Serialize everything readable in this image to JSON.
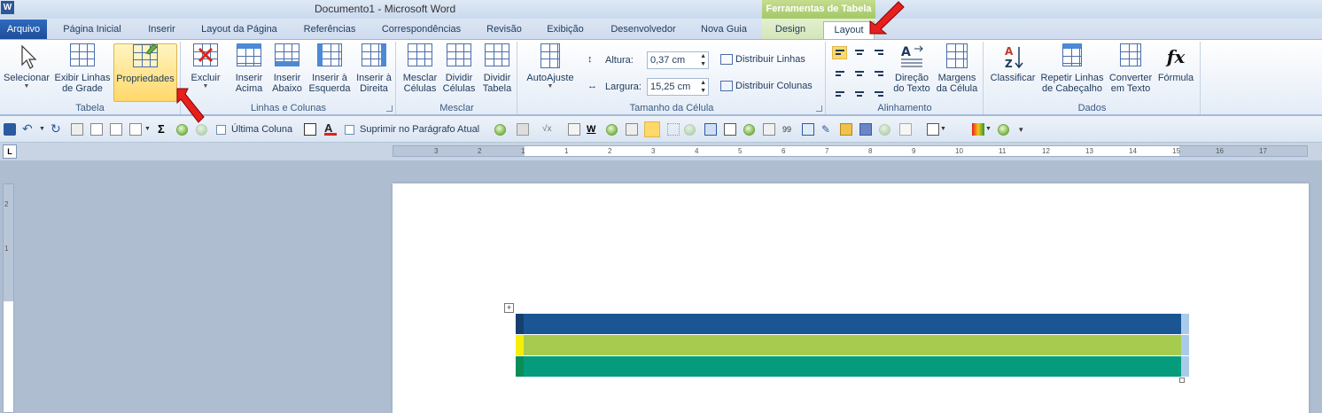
{
  "titlebar": {
    "title": "Documento1  -  Microsoft Word",
    "app_icon_letter": "W",
    "context_group": "Ferramentas de Tabela"
  },
  "tabs": [
    {
      "label": "Arquivo"
    },
    {
      "label": "Página Inicial"
    },
    {
      "label": "Inserir"
    },
    {
      "label": "Layout da Página"
    },
    {
      "label": "Referências"
    },
    {
      "label": "Correspondências"
    },
    {
      "label": "Revisão"
    },
    {
      "label": "Exibição"
    },
    {
      "label": "Desenvolvedor"
    },
    {
      "label": "Nova Guia"
    },
    {
      "label": "Design"
    },
    {
      "label": "Layout"
    }
  ],
  "ribbon": {
    "tabela": {
      "label": "Tabela",
      "selecionar": "Selecionar",
      "exibir_linhas_1": "Exibir Linhas",
      "exibir_linhas_2": "de Grade",
      "propriedades": "Propriedades"
    },
    "linhas_colunas": {
      "label": "Linhas e Colunas",
      "excluir": "Excluir",
      "inserir_acima_1": "Inserir",
      "inserir_acima_2": "Acima",
      "inserir_abaixo_1": "Inserir",
      "inserir_abaixo_2": "Abaixo",
      "inserir_esquerda_1": "Inserir à",
      "inserir_esquerda_2": "Esquerda",
      "inserir_direita_1": "Inserir à",
      "inserir_direita_2": "Direita"
    },
    "mesclar": {
      "label": "Mesclar",
      "mesclar_1": "Mesclar",
      "mesclar_2": "Células",
      "dividir_celulas_1": "Dividir",
      "dividir_celulas_2": "Células",
      "dividir_tabela_1": "Dividir",
      "dividir_tabela_2": "Tabela"
    },
    "tamanho": {
      "label": "Tamanho da Célula",
      "autoajuste": "AutoAjuste",
      "altura_label": "Altura:",
      "altura_value": "0,37 cm",
      "largura_label": "Largura:",
      "largura_value": "15,25 cm",
      "distribuir_linhas": "Distribuir Linhas",
      "distribuir_colunas": "Distribuir Colunas"
    },
    "alinhamento": {
      "label": "Alinhamento",
      "direcao_1": "Direção",
      "direcao_2": "do Texto",
      "margens_1": "Margens",
      "margens_2": "da Célula"
    },
    "dados": {
      "label": "Dados",
      "classificar": "Classificar",
      "repetir_1": "Repetir Linhas",
      "repetir_2": "de Cabeçalho",
      "converter_1": "Converter",
      "converter_2": "em Texto",
      "formula": "Fórmula",
      "fx_glyph": "fx",
      "az_glyph": "AZ"
    }
  },
  "qat": {
    "ultima_coluna": "Última Coluna",
    "suprimir": "Suprimir no Parágrafo Atual",
    "sigma": "Σ",
    "font_color_glyph": "A",
    "w_glyph": "W"
  },
  "ruler": {
    "tab_selector": "L",
    "numbers": [
      "3",
      "2",
      "1",
      "1",
      "2",
      "3",
      "4",
      "5",
      "6",
      "7",
      "8",
      "9",
      "10",
      "11",
      "12",
      "13",
      "14",
      "15",
      "16",
      "17"
    ],
    "vnumbers": [
      "2",
      "1"
    ]
  },
  "table": {
    "move_handle": "+",
    "rows": [
      {
        "color": "#1a5694",
        "accent": "#173f6e"
      },
      {
        "color": "#a6cb4f",
        "accent": "#f5ee09"
      },
      {
        "color": "#049c7d",
        "accent": "#0b8e55"
      }
    ]
  },
  "colors": {
    "ribbon_accent": "#1e395b",
    "context_tab": "#a3c866",
    "highlight": "#ffd86a",
    "arrow": "#e5201d"
  }
}
